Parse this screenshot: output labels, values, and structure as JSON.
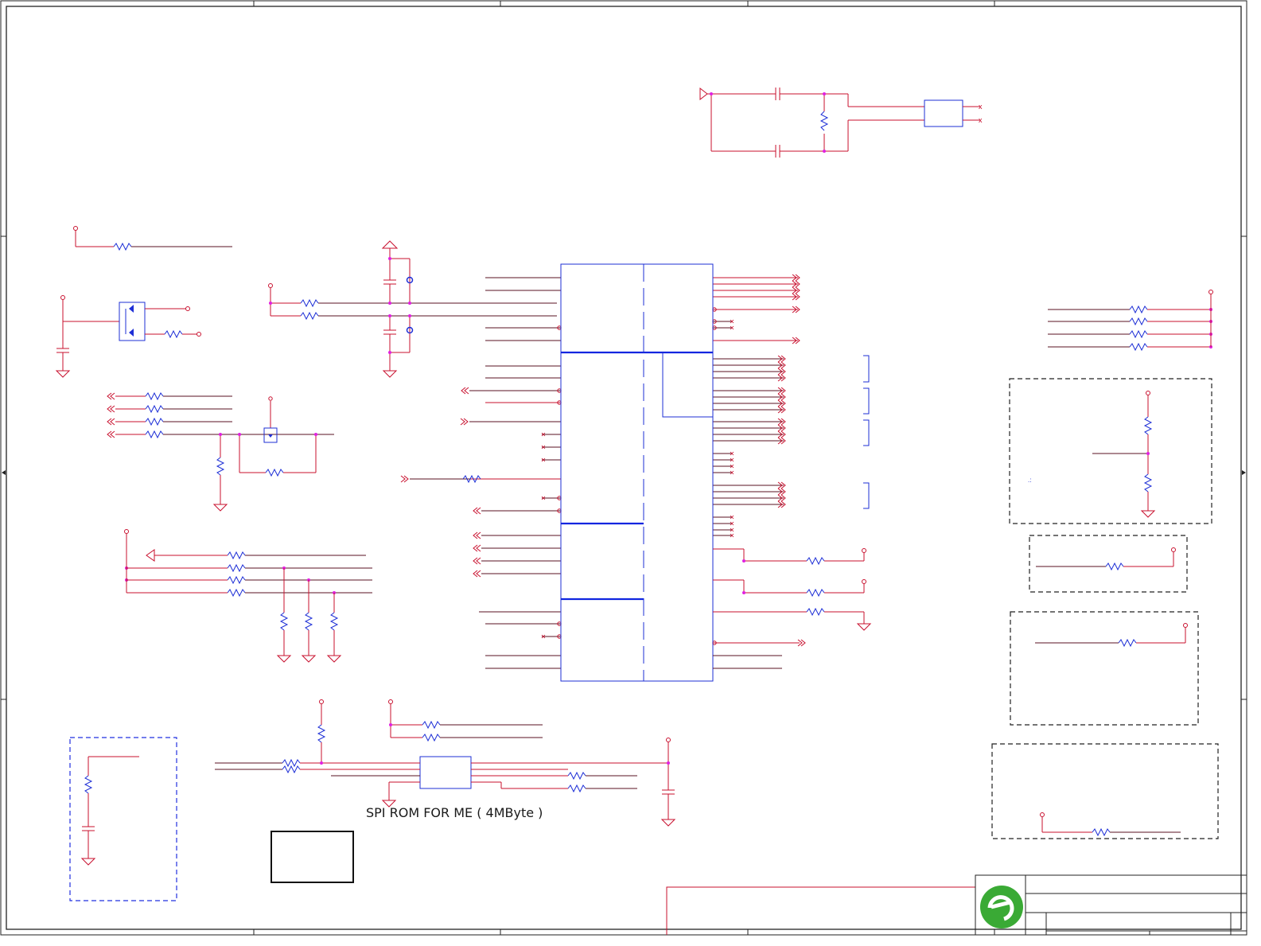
{
  "schematic": {
    "caption": "SPI ROM FOR ME ( 4MByte )",
    "logo": "green-e-logo",
    "colors": {
      "wire": "#c8102e",
      "net": "#5a1020",
      "component": "#1e2fd6",
      "junction": "#e020e0",
      "logo": "#3aaa35"
    }
  }
}
